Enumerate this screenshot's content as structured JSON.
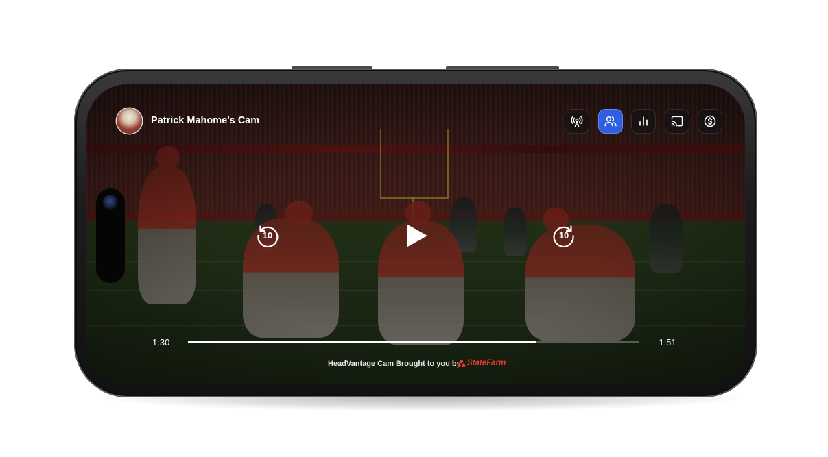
{
  "header": {
    "cam_title": "Patrick Mahome's Cam"
  },
  "toolbar": {
    "buttons": [
      {
        "icon": "broadcast-icon",
        "active": false
      },
      {
        "icon": "users-icon",
        "active": true
      },
      {
        "icon": "stats-icon",
        "active": false
      },
      {
        "icon": "cast-icon",
        "active": false
      },
      {
        "icon": "dollar-icon",
        "active": false
      }
    ],
    "accent_color": "#2f5fe0"
  },
  "player": {
    "rewind_label": "10",
    "forward_label": "10",
    "elapsed": "1:30",
    "remaining": "-1:51",
    "progress": 0.77
  },
  "sponsor": {
    "text": "HeadVantage Cam Brought to you by",
    "brand": "StateFarm",
    "brand_color": "#e23a2c"
  }
}
